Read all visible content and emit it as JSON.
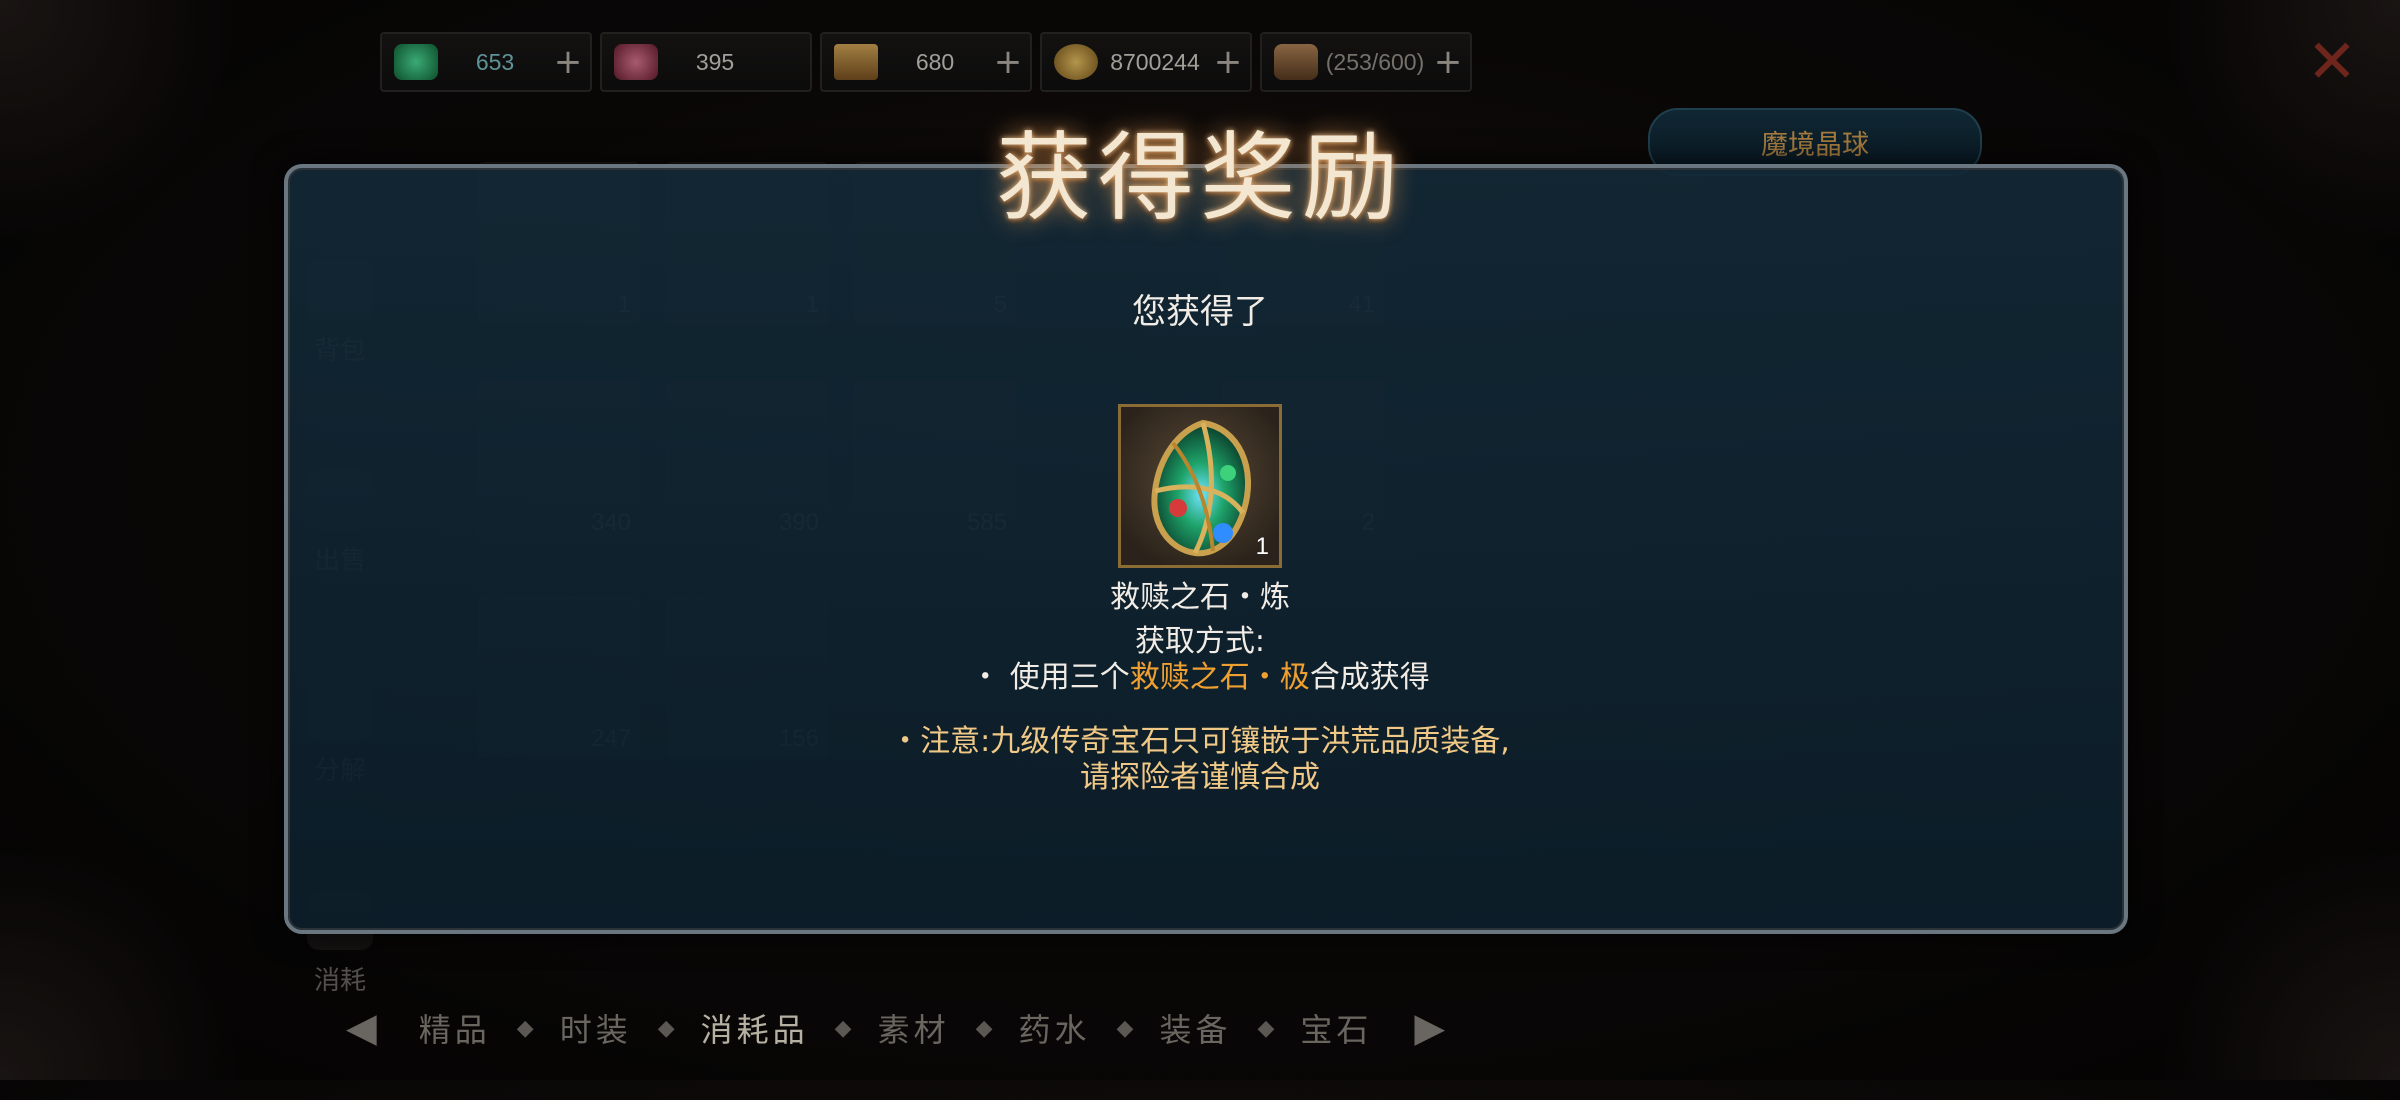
{
  "currencies": [
    {
      "value": "653",
      "plus": true,
      "color": "#2fb36f",
      "icon": "green-gem-icon"
    },
    {
      "value": "395",
      "plus": false,
      "color": "#c24a6a",
      "icon": "red-gem-icon"
    },
    {
      "value": "680",
      "plus": true,
      "color": "#b8893d",
      "icon": "ticket-icon"
    },
    {
      "value": "8700244",
      "plus": true,
      "color": "#c99a45",
      "icon": "gold-coins-icon"
    },
    {
      "value": "(253/600)",
      "plus": true,
      "color": "#9b7048",
      "icon": "stamina-icon"
    }
  ],
  "right_panel": {
    "tab_label": "魔境晶球"
  },
  "left_nav": [
    "背包",
    "出售",
    "分解",
    "消耗"
  ],
  "background_slots": [
    {
      "count": "1"
    },
    {
      "count": "1"
    },
    {
      "count": "5"
    },
    {
      "count": "41"
    },
    {
      "count": "340"
    },
    {
      "count": "390"
    },
    {
      "count": "585"
    },
    {
      "count": "2"
    },
    {
      "count": "247"
    },
    {
      "count": "156"
    }
  ],
  "bottom_tabs": [
    "精品",
    "时装",
    "消耗品",
    "素材",
    "药水",
    "装备",
    "宝石"
  ],
  "active_tab": "消耗品",
  "modal": {
    "title": "获得奖励",
    "obtained_label": "您获得了",
    "item": {
      "name": "救赎之石・炼",
      "count": "1",
      "icon": "redemption-stone-icon"
    },
    "acquisition_title": "获取方式:",
    "acquisition_prefix": "・ 使用三个",
    "acquisition_highlight": "救赎之石・极",
    "acquisition_suffix": "合成获得",
    "note_line1": "・注意:九级传奇宝石只可镶嵌于洪荒品质装备,",
    "note_line2": "请探险者谨慎合成",
    "highlight_color": "#f0a031"
  }
}
